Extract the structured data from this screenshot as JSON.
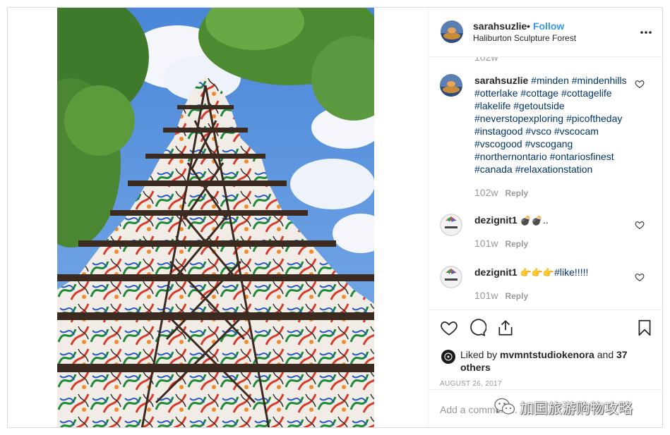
{
  "header": {
    "username": "sarahsuzlie",
    "separator": "•",
    "follow_label": "Follow",
    "location": "Haliburton Sculpture Forest"
  },
  "comments": {
    "previous_time": "102w",
    "items": [
      {
        "username": "sarahsuzlie",
        "hashtags": [
          "#minden",
          "#mindenhills",
          "#otterlake",
          "#cottage",
          "#cottagelife",
          "#lakelife",
          "#getoutside",
          "#neverstopexploring",
          "#picoftheday",
          "#instagood",
          "#vsco",
          "#vscocam",
          "#vscogood",
          "#vscogang",
          "#northernontario",
          "#ontariosfinest",
          "#canada",
          "#relaxationstation"
        ],
        "time": "102w",
        "reply_label": "Reply"
      },
      {
        "username": "dezignit1",
        "emoji": "💣💣",
        "text_suffix": "..",
        "time": "101w",
        "reply_label": "Reply"
      },
      {
        "username": "dezignit1",
        "emoji": "👉👉👉",
        "hashtag": "#like!!!!!",
        "time": "101w",
        "reply_label": "Reply"
      }
    ]
  },
  "likes": {
    "prefix": "Liked by",
    "user": "mvmntstudiokenora",
    "connector": "and",
    "others": "37 others"
  },
  "post_date": "AUGUST 26, 2017",
  "add_comment": {
    "placeholder": "Add a comment..."
  },
  "watermark": {
    "text": "加国旅游购物攻略"
  },
  "icons": {
    "more": "more-horizontal-icon",
    "like": "heart-outline-icon",
    "comment": "speech-bubble-icon",
    "share": "share-upload-icon",
    "save": "bookmark-icon"
  },
  "colors": {
    "link_blue": "#3897f0",
    "hashtag_blue": "#003569",
    "muted_gray": "#999999",
    "border": "#dbdbdb"
  }
}
